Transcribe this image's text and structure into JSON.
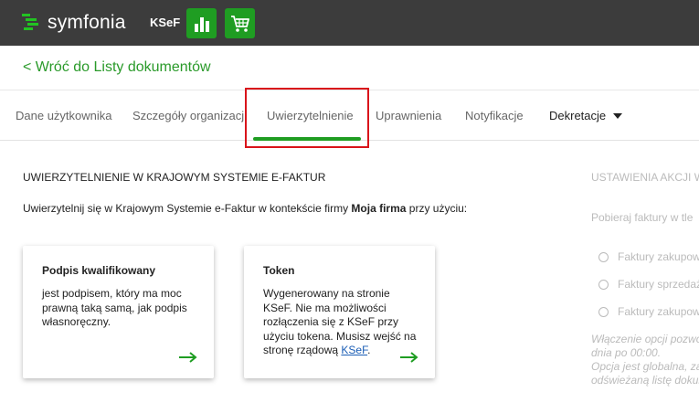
{
  "header": {
    "brand": "symfonia",
    "module_label": "KSeF",
    "chart_button_icon": "bar-chart-icon",
    "cart_button_icon": "cart-icon",
    "accent_color": "#1f9d22"
  },
  "back_link": "< Wróć do Listy dokumentów",
  "tabs": [
    {
      "label": "Dane użytkownika"
    },
    {
      "label": "Szczegóły organizacji"
    },
    {
      "label": "Uwierzytelnienie",
      "active": true
    },
    {
      "label": "Uprawnienia"
    },
    {
      "label": "Notyfikacje"
    },
    {
      "label": "Dekretacje"
    }
  ],
  "main": {
    "section_title": "UWIERZYTELNIENIE W KRAJOWYM SYSTEMIE E-FAKTUR",
    "intro_before": "Uwierzytelnij się w Krajowym Systemie e-Faktur w kontekście firmy ",
    "intro_company": "Moja firma",
    "intro_after": " przy użyciu:",
    "cards": [
      {
        "title": "Podpis kwalifikowany",
        "description": "jest podpisem, który ma moc prawną taką samą, jak podpis własnoręczny."
      },
      {
        "title": "Token",
        "description": "Wygenerowany na stronie KSeF. Nie ma możliwości rozłączenia się z KSeF przy użyciu tokena. Musisz wejść na stronę rządową ",
        "link": "KSeF",
        "description_end": "."
      }
    ]
  },
  "right_panel": {
    "title": "USTAWIENIA AKCJI W",
    "subtitle": "Pobieraj faktury w tle",
    "options": [
      "Faktury zakupow",
      "Faktury sprzedaż",
      "Faktury zakupow"
    ],
    "note_lines": [
      "Włączenie opcji pozwo",
      "dnia po 00:00.",
      "Opcja jest globalna, za",
      "odświeżaną listę dokun"
    ]
  }
}
